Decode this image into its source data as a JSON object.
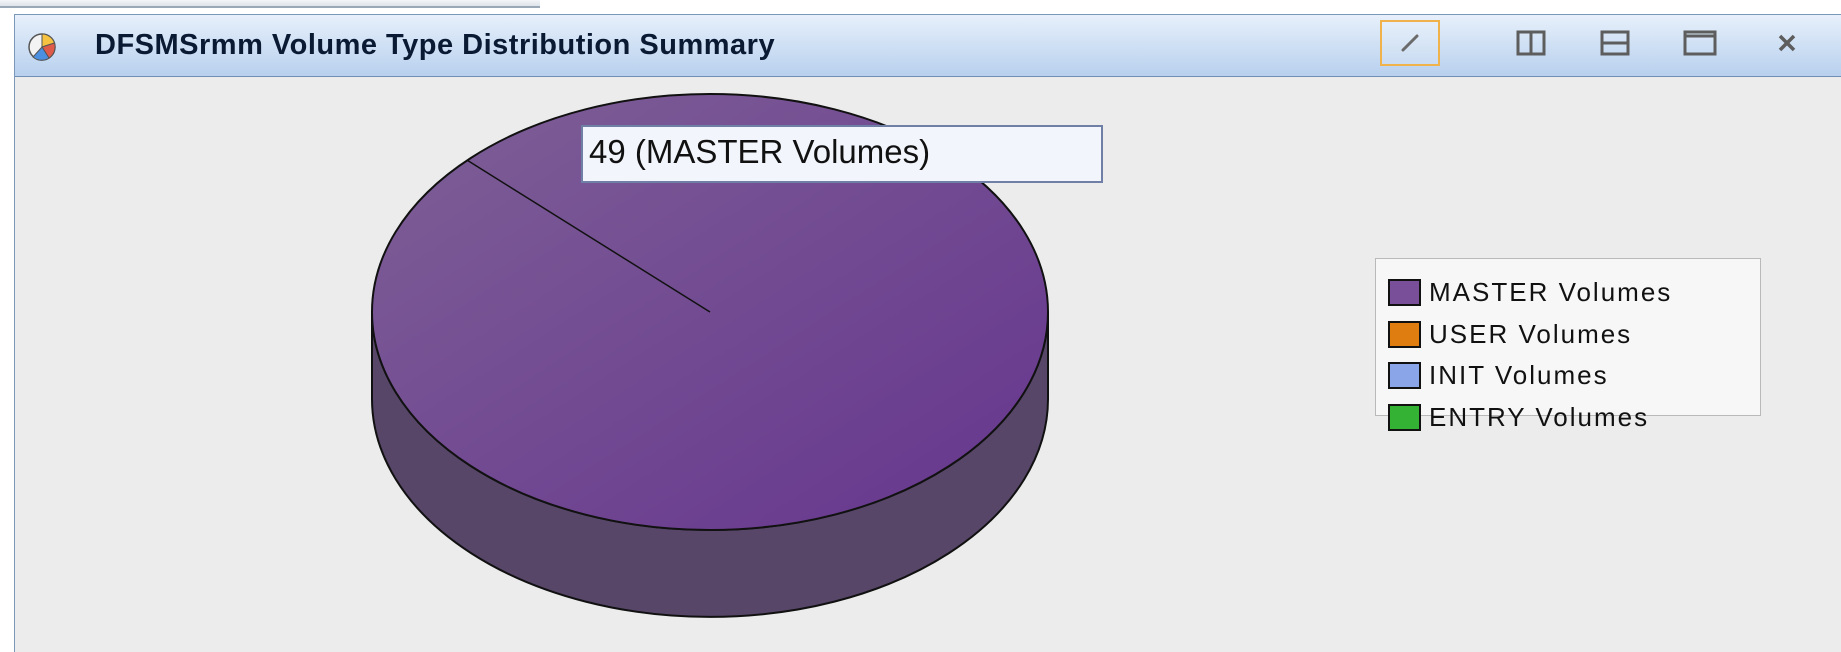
{
  "window": {
    "title": "DFSMSrmm Volume Type Distribution Summary",
    "icon": "pie-chart-icon",
    "controls": [
      {
        "name": "edit-button",
        "icon": "pencil-icon",
        "active": true
      },
      {
        "name": "split-vertical-button",
        "icon": "columns-icon"
      },
      {
        "name": "split-horizontal-button",
        "icon": "rows-icon"
      },
      {
        "name": "maximize-button",
        "icon": "maximize-icon"
      },
      {
        "name": "close-button",
        "icon": "close-icon"
      }
    ]
  },
  "tooltip": {
    "text": "49 (MASTER Volumes)"
  },
  "legend": {
    "items": [
      {
        "label": "MASTER Volumes",
        "color": "#7a4f9a"
      },
      {
        "label": "USER Volumes",
        "color": "#e07d10"
      },
      {
        "label": "INIT Volumes",
        "color": "#8aa6e8"
      },
      {
        "label": "ENTRY Volumes",
        "color": "#33b233"
      }
    ]
  },
  "chart_data": {
    "type": "pie",
    "style": "3d",
    "title": "",
    "categories": [
      "MASTER Volumes",
      "USER Volumes",
      "INIT Volumes",
      "ENTRY Volumes"
    ],
    "values": [
      49,
      0,
      0,
      0
    ],
    "colors": [
      "#7a4f9a",
      "#e07d10",
      "#8aa6e8",
      "#33b233"
    ],
    "legend": "right",
    "hovered_slice": "MASTER Volumes"
  }
}
